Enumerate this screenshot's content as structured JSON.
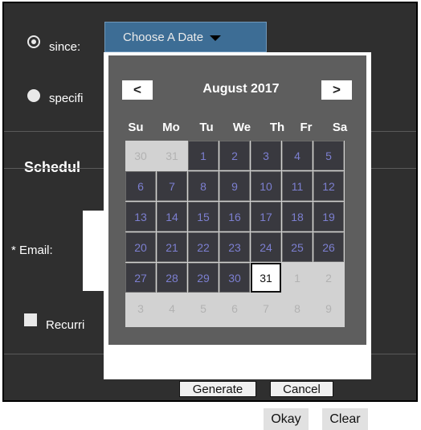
{
  "form": {
    "since_label": "since:",
    "specific_label": "specifi",
    "choose_date_label": "Choose A Date",
    "schedule_heading": "Schedul",
    "email_label": "* Email:",
    "recurring_label": "Recurri"
  },
  "datepicker": {
    "month_label": "August 2017",
    "prev_symbol": "<",
    "next_symbol": ">",
    "weekdays": [
      "Su",
      "Mo",
      "Tu",
      "We",
      "Th",
      "Fr",
      "Sa"
    ],
    "weeks": [
      [
        "30",
        "31",
        "1",
        "2",
        "3",
        "4",
        "5"
      ],
      [
        "6",
        "7",
        "8",
        "9",
        "10",
        "11",
        "12"
      ],
      [
        "13",
        "14",
        "15",
        "16",
        "17",
        "18",
        "19"
      ],
      [
        "20",
        "21",
        "22",
        "23",
        "24",
        "25",
        "26"
      ],
      [
        "27",
        "28",
        "29",
        "30",
        "31",
        "1",
        "2"
      ],
      [
        "3",
        "4",
        "5",
        "6",
        "7",
        "8",
        "9"
      ]
    ],
    "selected_day": "31",
    "okay_label": "Okay",
    "clear_label": "Clear"
  },
  "actions": {
    "generate_label": "Generate",
    "cancel_label": "Cancel"
  }
}
